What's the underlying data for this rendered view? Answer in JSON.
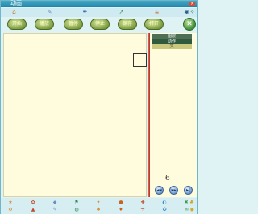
{
  "window": {
    "title": "动画"
  },
  "icons_top": [
    {
      "name": "home-icon",
      "glyph": "⌂",
      "color": "#c47a1e"
    },
    {
      "name": "pencil-icon",
      "glyph": "✎",
      "color": "#6a8fc5"
    },
    {
      "name": "brush-icon",
      "glyph": "✒",
      "color": "#2d6fb3"
    },
    {
      "name": "arrow-icon",
      "glyph": "➚",
      "color": "#3b9b4c"
    },
    {
      "name": "cup-icon",
      "glyph": "☕",
      "color": "#c9621c"
    },
    {
      "name": "eye-icon",
      "glyph": "◉",
      "color": "#2e5f8a"
    },
    {
      "name": "wrench-icon",
      "glyph": "✧",
      "color": "#2e8a5a"
    }
  ],
  "buttons": [
    {
      "name": "oval-button-1",
      "label": "开始"
    },
    {
      "name": "oval-button-2",
      "label": "播放"
    },
    {
      "name": "oval-button-3",
      "label": "暂停"
    },
    {
      "name": "oval-button-4",
      "label": "停止"
    },
    {
      "name": "oval-button-5",
      "label": "保存"
    },
    {
      "name": "oval-button-6",
      "label": "打开"
    }
  ],
  "close_button": "×",
  "right_list": [
    "图层",
    "动作",
    "文"
  ],
  "frame_number": "6",
  "nav_buttons": [
    "◂◂",
    "▸▸",
    "▸|"
  ],
  "icons_bottom": [
    "★",
    "✿",
    "◆",
    "⚑",
    "✦",
    "●",
    "✚",
    "◐",
    "✖",
    "♣",
    "⚙",
    "▲",
    "✎",
    "◍",
    "✱",
    "♦",
    "☂",
    "✪",
    "✉",
    "◉"
  ]
}
